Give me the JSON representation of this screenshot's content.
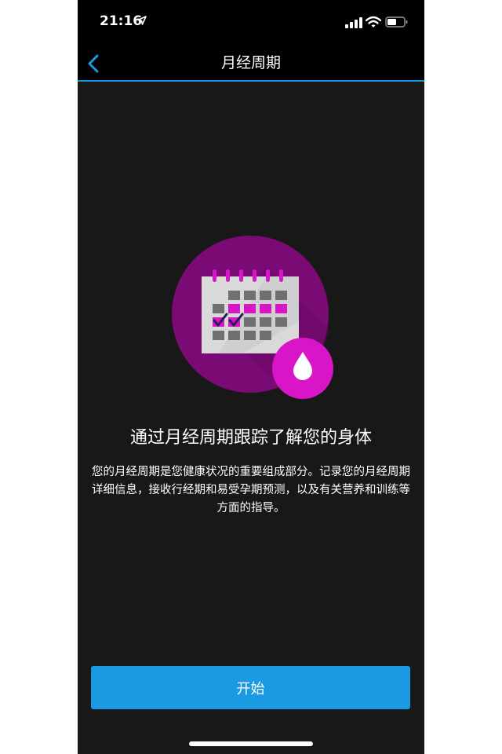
{
  "status_bar": {
    "time": "21:16"
  },
  "header": {
    "title": "月经周期"
  },
  "main": {
    "headline": "通过月经周期跟踪了解您的身体",
    "description": "您的月经周期是您健康状况的重要组成部分。记录您的月经周期详细信息，接收行经期和易受孕期预测，以及有关营养和训练等方面的指导。",
    "start_label": "开始"
  },
  "icons": {
    "back": "chevron-left-icon",
    "location": "location-arrow-icon",
    "signal": "cellular-signal-icon",
    "wifi": "wifi-icon",
    "battery": "battery-icon",
    "calendar": "calendar-icon",
    "drop": "water-drop-icon"
  },
  "colors": {
    "accent": "#1c99e3",
    "header_border": "#1a8fd6",
    "background": "#181818",
    "circle_purple": "#7a0a74",
    "magenta": "#d816c8",
    "check": "#2a1a5c"
  }
}
